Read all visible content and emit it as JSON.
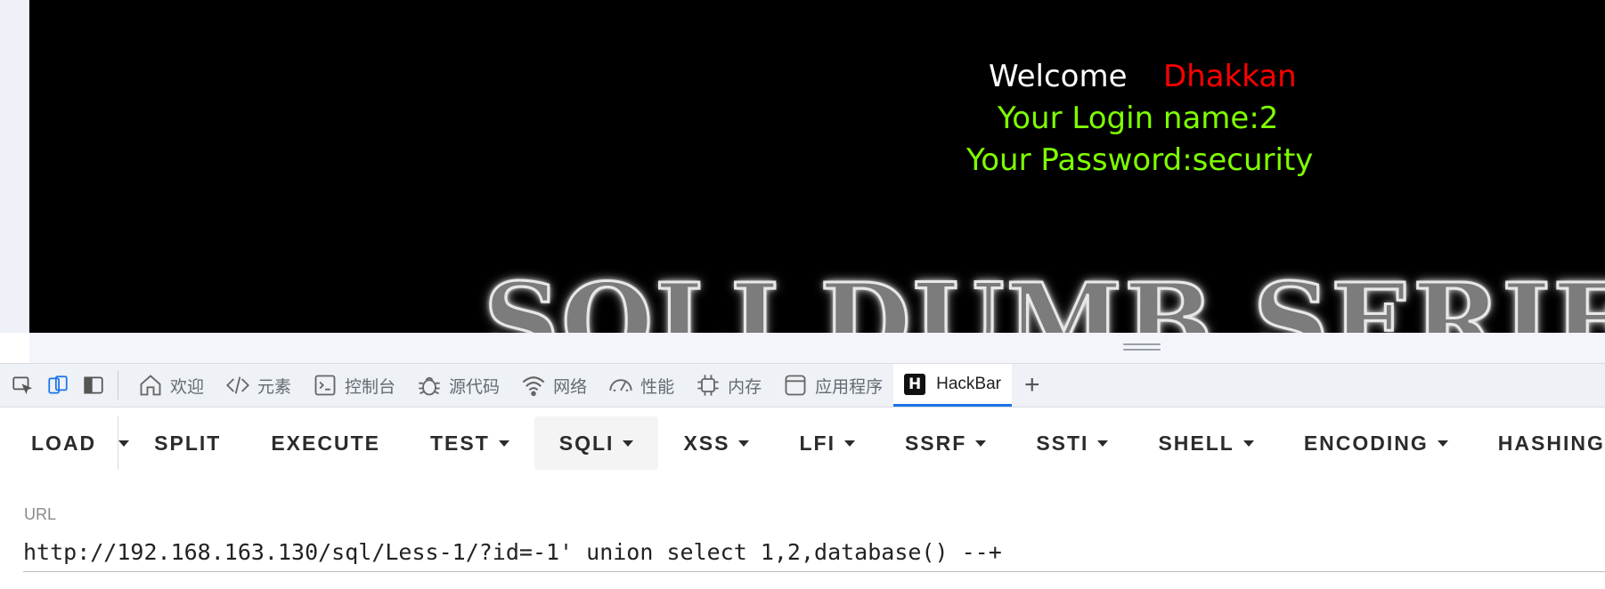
{
  "page": {
    "welcome": "Welcome",
    "user_name": "Dhakkan",
    "login_line": "Your Login name:2",
    "password_line": "Your Password:security",
    "banner_text": "SQLI DUMB SERIES"
  },
  "devtools": {
    "tabs": [
      {
        "label": "欢迎",
        "icon": "home-icon"
      },
      {
        "label": "元素",
        "icon": "code-icon"
      },
      {
        "label": "控制台",
        "icon": "console-icon"
      },
      {
        "label": "源代码",
        "icon": "bug-icon"
      },
      {
        "label": "网络",
        "icon": "wifi-icon"
      },
      {
        "label": "性能",
        "icon": "gauge-icon"
      },
      {
        "label": "内存",
        "icon": "chip-icon"
      },
      {
        "label": "应用程序",
        "icon": "app-icon"
      },
      {
        "label": "HackBar",
        "icon": "hackbar-logo-icon",
        "active": true
      }
    ],
    "hackbar_logo_letter": "H",
    "add_tab_label": "+"
  },
  "hackbar": {
    "buttons": {
      "load": "LOAD",
      "split": "SPLIT",
      "execute": "EXECUTE",
      "test": "TEST",
      "sqli": "SQLI",
      "xss": "XSS",
      "lfi": "LFI",
      "ssrf": "SSRF",
      "ssti": "SSTI",
      "shell": "SHELL",
      "encoding": "ENCODING",
      "hashing": "HASHING"
    },
    "url_label": "URL",
    "url_value": "http://192.168.163.130/sql/Less-1/?id=-1' union select 1,2,database() --+"
  },
  "colors": {
    "accent": "#1a73e8",
    "welcome_text": "#ffffff",
    "user_name_text": "#ff0000",
    "credential_text": "#7fff00"
  }
}
